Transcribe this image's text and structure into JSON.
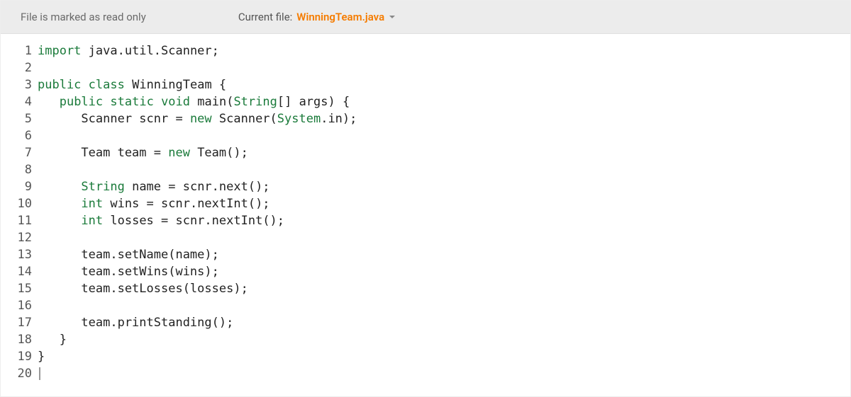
{
  "header": {
    "readonly_label": "File is marked as read only",
    "current_file_label": "Current file:",
    "current_file_name": "WinningTeam.java"
  },
  "editor": {
    "line_count": 20,
    "lines": [
      {
        "n": 1,
        "tokens": [
          {
            "t": "import",
            "c": "tok-keyword"
          },
          {
            "t": " java.util.Scanner;",
            "c": "tok-plain"
          }
        ]
      },
      {
        "n": 2,
        "tokens": []
      },
      {
        "n": 3,
        "tokens": [
          {
            "t": "public",
            "c": "tok-keyword"
          },
          {
            "t": " ",
            "c": "tok-plain"
          },
          {
            "t": "class",
            "c": "tok-keyword"
          },
          {
            "t": " WinningTeam {",
            "c": "tok-plain"
          }
        ]
      },
      {
        "n": 4,
        "tokens": [
          {
            "t": "   ",
            "c": "tok-plain"
          },
          {
            "t": "public",
            "c": "tok-keyword"
          },
          {
            "t": " ",
            "c": "tok-plain"
          },
          {
            "t": "static",
            "c": "tok-keyword"
          },
          {
            "t": " ",
            "c": "tok-plain"
          },
          {
            "t": "void",
            "c": "tok-keyword"
          },
          {
            "t": " main(",
            "c": "tok-plain"
          },
          {
            "t": "String",
            "c": "tok-type"
          },
          {
            "t": "[] args) {",
            "c": "tok-plain"
          }
        ]
      },
      {
        "n": 5,
        "tokens": [
          {
            "t": "      Scanner scnr = ",
            "c": "tok-plain"
          },
          {
            "t": "new",
            "c": "tok-keyword"
          },
          {
            "t": " Scanner(",
            "c": "tok-plain"
          },
          {
            "t": "System",
            "c": "tok-type"
          },
          {
            "t": ".in);",
            "c": "tok-plain"
          }
        ]
      },
      {
        "n": 6,
        "tokens": []
      },
      {
        "n": 7,
        "tokens": [
          {
            "t": "      Team team = ",
            "c": "tok-plain"
          },
          {
            "t": "new",
            "c": "tok-keyword"
          },
          {
            "t": " Team();",
            "c": "tok-plain"
          }
        ]
      },
      {
        "n": 8,
        "tokens": []
      },
      {
        "n": 9,
        "tokens": [
          {
            "t": "      ",
            "c": "tok-plain"
          },
          {
            "t": "String",
            "c": "tok-type"
          },
          {
            "t": " name = scnr.next();",
            "c": "tok-plain"
          }
        ]
      },
      {
        "n": 10,
        "tokens": [
          {
            "t": "      ",
            "c": "tok-plain"
          },
          {
            "t": "int",
            "c": "tok-keyword"
          },
          {
            "t": " wins = scnr.nextInt();",
            "c": "tok-plain"
          }
        ]
      },
      {
        "n": 11,
        "tokens": [
          {
            "t": "      ",
            "c": "tok-plain"
          },
          {
            "t": "int",
            "c": "tok-keyword"
          },
          {
            "t": " losses = scnr.nextInt();",
            "c": "tok-plain"
          }
        ]
      },
      {
        "n": 12,
        "tokens": []
      },
      {
        "n": 13,
        "tokens": [
          {
            "t": "      team.setName(name);",
            "c": "tok-plain"
          }
        ]
      },
      {
        "n": 14,
        "tokens": [
          {
            "t": "      team.setWins(wins);",
            "c": "tok-plain"
          }
        ]
      },
      {
        "n": 15,
        "tokens": [
          {
            "t": "      team.setLosses(losses);",
            "c": "tok-plain"
          }
        ]
      },
      {
        "n": 16,
        "tokens": []
      },
      {
        "n": 17,
        "tokens": [
          {
            "t": "      team.printStanding();",
            "c": "tok-plain"
          }
        ]
      },
      {
        "n": 18,
        "tokens": [
          {
            "t": "   }",
            "c": "tok-plain"
          }
        ]
      },
      {
        "n": 19,
        "tokens": [
          {
            "t": "}",
            "c": "tok-plain"
          }
        ]
      },
      {
        "n": 20,
        "tokens": [],
        "cursor": true
      }
    ]
  }
}
